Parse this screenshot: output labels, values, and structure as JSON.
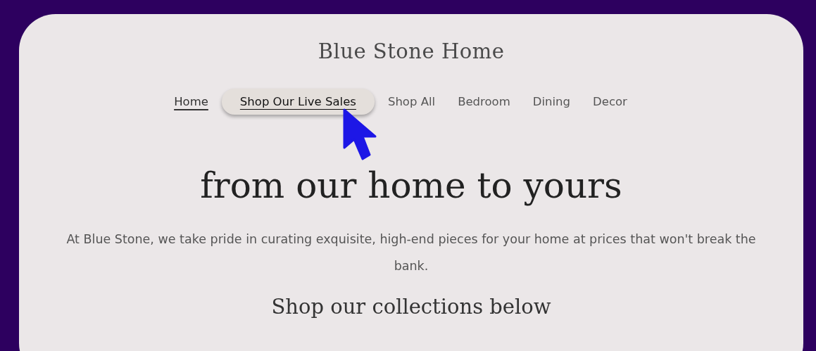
{
  "site_title": "Blue Stone Home",
  "nav": [
    {
      "label": "Home",
      "selected": true,
      "highlighted": false
    },
    {
      "label": "Shop Our Live Sales",
      "selected": false,
      "highlighted": true
    },
    {
      "label": "Shop All",
      "selected": false,
      "highlighted": false
    },
    {
      "label": "Bedroom",
      "selected": false,
      "highlighted": false
    },
    {
      "label": "Dining",
      "selected": false,
      "highlighted": false
    },
    {
      "label": "Decor",
      "selected": false,
      "highlighted": false
    }
  ],
  "headline": "from our home to yours",
  "intro": "At Blue Stone, we take pride in curating exquisite, high-end pieces for your home at prices that won't break the bank.",
  "section_heading": "Shop our collections below"
}
